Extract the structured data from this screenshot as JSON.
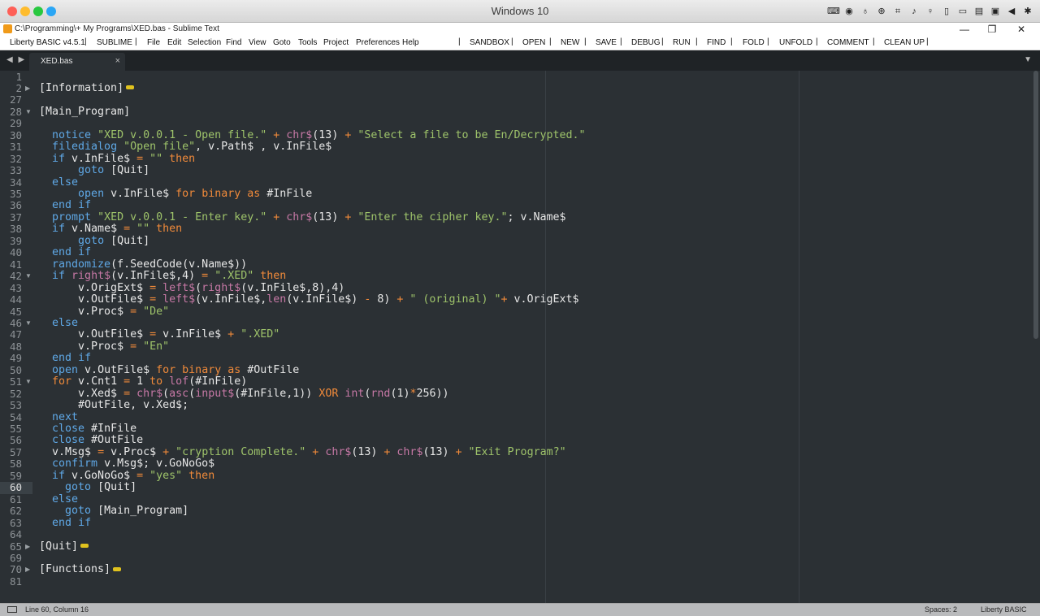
{
  "host": {
    "title": "Windows 10",
    "traffic_lights": [
      "#fe5f57",
      "#febc2e",
      "#28c840",
      "#2aa6f5"
    ],
    "tray_icons": [
      "keyboard-icon",
      "usb-icon",
      "mic-icon",
      "zoom-icon",
      "crop-icon",
      "volume-icon",
      "microphone-icon",
      "phone-icon",
      "camera-icon",
      "folder-icon",
      "video-icon",
      "back-icon",
      "gear-icon"
    ]
  },
  "window": {
    "title": "C:\\Programming\\+ My Programs\\XED.bas - Sublime Text",
    "minimize": "—",
    "restore": "❐",
    "close": "✕"
  },
  "menu": {
    "items": [
      "Liberty BASIC v4.5.1",
      "SUBLIME",
      "File",
      "Edit",
      "Selection",
      "Find",
      "View",
      "Goto",
      "Tools",
      "Project",
      "Preferences",
      "Help",
      "SANDBOX",
      "OPEN",
      "NEW",
      "SAVE",
      "DEBUG",
      "RUN",
      "FIND",
      "FOLD",
      "UNFOLD",
      "COMMENT",
      "CLEAN UP"
    ]
  },
  "tabs": {
    "nav": "◀ ▶",
    "active": {
      "label": "XED.bas",
      "close": "×"
    },
    "overflow": "▼"
  },
  "editor": {
    "line_numbers": [
      "1",
      "2",
      "27",
      "28",
      "29",
      "30",
      "31",
      "32",
      "33",
      "34",
      "35",
      "36",
      "37",
      "38",
      "39",
      "40",
      "41",
      "42",
      "43",
      "44",
      "45",
      "46",
      "47",
      "48",
      "49",
      "50",
      "51",
      "52",
      "53",
      "54",
      "55",
      "56",
      "57",
      "58",
      "59",
      "60",
      "61",
      "62",
      "63",
      "64",
      "65",
      "69",
      "70",
      "81"
    ],
    "current_line": "60",
    "lines": [
      "",
      "[Information]",
      "",
      "[Main_Program]",
      "",
      "  notice \"XED v.0.0.1 - Open file.\" + chr$(13) + \"Select a file to be En/Decrypted.\"",
      "  filedialog \"Open file\", v.Path$ , v.InFile$",
      "  if v.InFile$ = \"\" then",
      "      goto [Quit]",
      "  else",
      "      open v.InFile$ for binary as #InFile",
      "  end if",
      "  prompt \"XED v.0.0.1 - Enter key.\" + chr$(13) + \"Enter the cipher key.\"; v.Name$",
      "  if v.Name$ = \"\" then",
      "      goto [Quit]",
      "  end if",
      "  randomize(f.SeedCode(v.Name$))",
      "  if right$(v.InFile$,4) = \".XED\" then",
      "      v.OrigExt$ = left$(right$(v.InFile$,8),4)",
      "      v.OutFile$ = left$(v.InFile$,len(v.InFile$) - 8) + \" (original) \"+ v.OrigExt$",
      "      v.Proc$ = \"De\"",
      "  else",
      "      v.OutFile$ = v.InFile$ + \".XED\"",
      "      v.Proc$ = \"En\"",
      "  end if",
      "  open v.OutFile$ for binary as #OutFile",
      "  for v.Cnt1 = 1 to lof(#InFile)",
      "      v.Xed$ = chr$(asc(input$(#InFile,1)) XOR int(rnd(1)*256))",
      "      #OutFile, v.Xed$;",
      "  next",
      "  close #InFile",
      "  close #OutFile",
      "  v.Msg$ = v.Proc$ + \"cryption Complete.\" + chr$(13) + chr$(13) + \"Exit Program?\"",
      "  confirm v.Msg$; v.GoNoGo$",
      "  if v.GoNoGo$ = \"yes\" then",
      "    goto [Quit]",
      "  else",
      "    goto [Main_Program]",
      "  end if",
      "",
      "[Quit]",
      "",
      "[Functions]",
      ""
    ],
    "folds": {
      "2": "▶",
      "28": "▼",
      "42": "▼",
      "46": "▼",
      "51": "▼",
      "65": "▶",
      "70": "▶"
    }
  },
  "status": {
    "position": "Line 60, Column 16",
    "spaces": "Spaces: 2",
    "syntax": "Liberty BASIC"
  }
}
